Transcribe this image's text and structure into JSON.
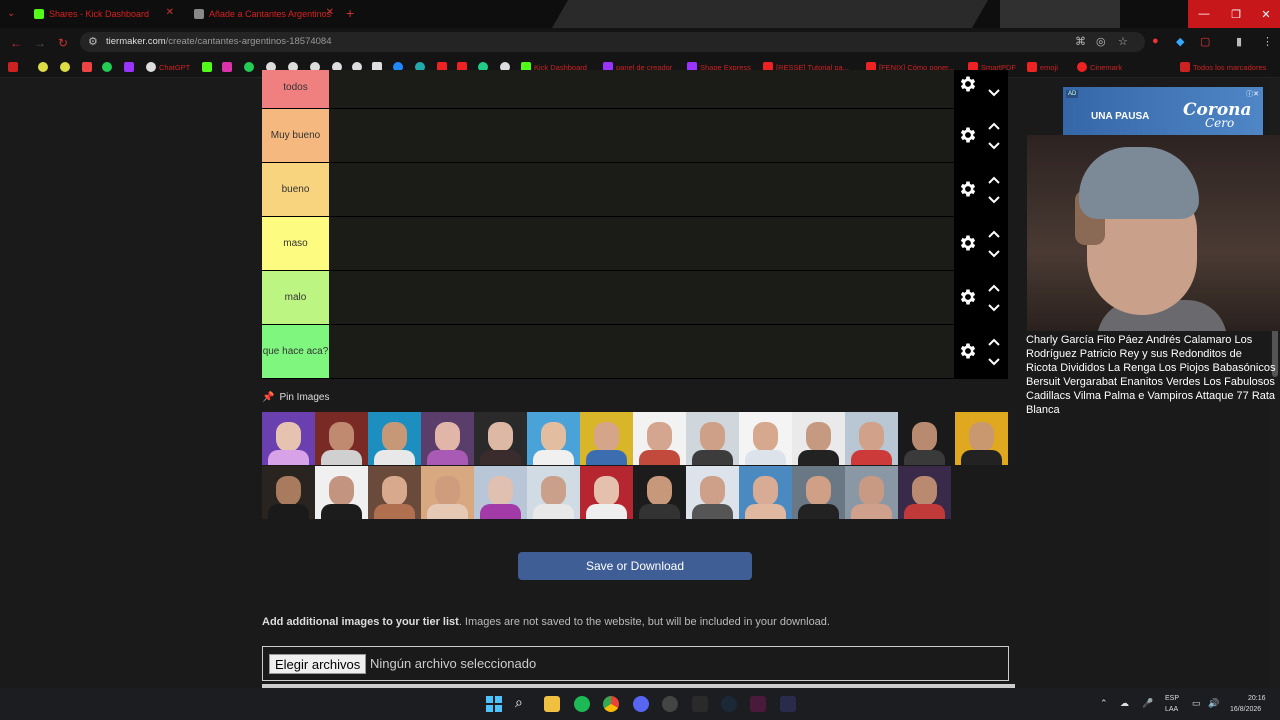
{
  "browser": {
    "tabs": [
      {
        "title": "Shares - Kick Dashboard"
      },
      {
        "title": "Añade a Cantantes Argentinos"
      }
    ],
    "url_host": "tiermaker.com",
    "url_path": "/create/cantantes-argentinos-18574084",
    "bookmarks": [
      "ChatGPT",
      "Kick Dashboard",
      "panel de creador",
      "Shape Express",
      "[RESSE] Tutorial pa...",
      "[FENIX] Cómo poner...",
      "SmartPDF",
      "emoji",
      "Cinemark",
      "Todos los marcadores"
    ]
  },
  "tier_list": {
    "tiers": [
      {
        "label": "todos",
        "color": "#f08080"
      },
      {
        "label": "Muy bueno",
        "color": "#f5b97f"
      },
      {
        "label": "bueno",
        "color": "#f8d47f"
      },
      {
        "label": "maso",
        "color": "#fdfc80"
      },
      {
        "label": "malo",
        "color": "#bdf582"
      },
      {
        "label": "que hace aca?",
        "color": "#7ff77f"
      }
    ],
    "pin_label": "Pin Images",
    "save_label": "Save or Download",
    "add_images_bold": "Add additional images to your tier list",
    "add_images_rest": ". Images are not saved to the website, but will be included in your download.",
    "file_button": "Elegir archivos",
    "file_status": "Ningún archivo seleccionado"
  },
  "ad": {
    "tag": "AD",
    "slogan": "UNA PAUSA",
    "brand_line1": "Corona",
    "brand_line2": "Cero"
  },
  "stream_overlay": {
    "music_list": "Charly García Fito Páez Andrés Calamaro Los Rodríguez Patricio Rey y sus Redonditos de Ricota Divididos La Renga Los Piojos Babasónicos Bersuit Vergarabat Enanitos Verdes Los Fabulosos Cadillacs Vilma Palma e Vampiros Attaque 77 Rata Blanca"
  },
  "taskbar": {
    "lang": "ESP",
    "lang_sub": "LAA",
    "time": "20:16",
    "date": "16/8/2026"
  },
  "accent_colors": {
    "save_button": "#3f5e96",
    "chrome_red": "#c8171b"
  }
}
